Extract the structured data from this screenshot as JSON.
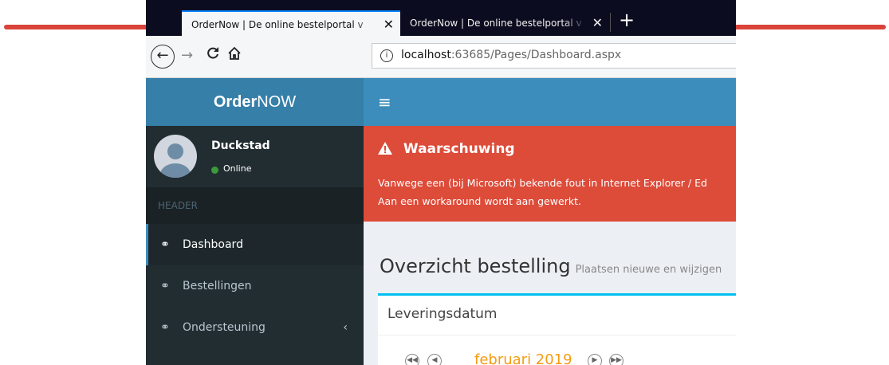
{
  "browser": {
    "tabs": [
      {
        "title": "OrderNow | De online bestelportal v",
        "close": "✕",
        "active": true
      },
      {
        "title": "OrderNow | De online bestelportal v",
        "close": "✕",
        "active": false
      }
    ],
    "new_tab": "+",
    "nav": {
      "back": "←",
      "forward": "→",
      "reload": "C",
      "home": "⌂"
    },
    "url": {
      "info": "i",
      "host": "localhost",
      "path": ":63685/Pages/Dashboard.aspx"
    }
  },
  "sidebar": {
    "logo_bold": "Order",
    "logo_regular": "NOW",
    "user": {
      "name": "Duckstad",
      "status": "Online"
    },
    "header": "HEADER",
    "items": [
      {
        "label": "Dashboard",
        "icon": "link-icon",
        "active": true
      },
      {
        "label": "Bestellingen",
        "icon": "link-icon",
        "active": false
      },
      {
        "label": "Ondersteuning",
        "icon": "link-icon",
        "active": false,
        "chevron": "‹"
      }
    ]
  },
  "topbar": {
    "menu_icon": "≡"
  },
  "alert": {
    "title": "Waarschuwing",
    "line1": "Vanwege een (bij Microsoft) bekende fout in Internet Explorer / Ed",
    "line2": "Aan een workaround wordt aan gewerkt."
  },
  "content": {
    "title": "Overzicht bestelling",
    "subtitle": "Plaatsen nieuwe en wijzigen",
    "box_title": "Leveringsdatum",
    "calendar": {
      "month": "februari 2019"
    }
  },
  "colors": {
    "accent": "#3c8dbc",
    "logo_bar": "#367fa9",
    "sidebar": "#222d32",
    "alert": "#dd4b39",
    "annotation_arrow": "#d9433a"
  }
}
